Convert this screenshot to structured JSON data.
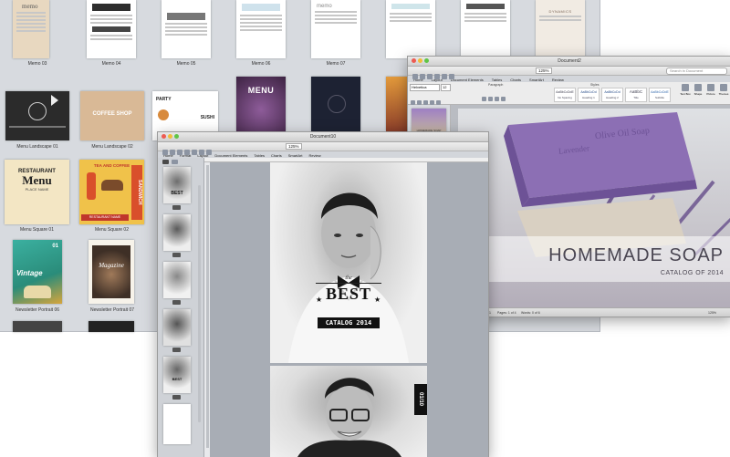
{
  "template_browser": {
    "top_labels": [
      "Memo 03",
      "Memo 04",
      "Memo 05",
      "Memo 06",
      "Memo 07"
    ],
    "memo_word": "memo",
    "dynamics_word": "DYNAMICS",
    "row2_labels": [
      "Menu Landscape 01",
      "Menu Landscape 02"
    ],
    "coffee_shop": "COFFEE SHOP",
    "party": "PARTY",
    "sushi": "SUSHI",
    "menu_word": "MENU",
    "row3_labels": [
      "Menu Square 01",
      "Menu Square 02"
    ],
    "restaurant": "RESTAURANT",
    "menu_big": "Menu",
    "place_name": "PLACE NAME",
    "tea_coffee": "TEA AND COFFEE",
    "sandwich": "SANDWICH",
    "restaurant_name": "RESTAURANT NAME",
    "row4_labels": [
      "Newsletter Portrait 06",
      "Newsletter Portrait 07"
    ],
    "vintage": "Vintage",
    "newsletter_badge": "01",
    "magazine": "Magazine"
  },
  "word_window": {
    "title": "Document2",
    "search_placeholder": "Search in Document",
    "tabs": [
      "Home",
      "Layout",
      "Document Elements",
      "Tables",
      "Charts",
      "SmartArt",
      "Review"
    ],
    "font_name": "Helvetica",
    "font_size": "12",
    "zoom": "125%",
    "styles": [
      {
        "sample": "AaBbCcDdE",
        "name": "No Spacing"
      },
      {
        "sample": "AaBbCcDd",
        "name": "Heading 1"
      },
      {
        "sample": "AaBbCcDd",
        "name": "Heading 2"
      },
      {
        "sample": "AaBbC",
        "name": "Title"
      },
      {
        "sample": "AaBbCcDdE",
        "name": "Subtitle"
      }
    ],
    "ribbon_groups": [
      "Paragraph",
      "Styles"
    ],
    "right_tools": [
      "Text Box",
      "Shape",
      "Picture",
      "Themes"
    ],
    "thumb_caption": "HOMEMADE SOAP",
    "soap_engraving": "Olive Oil Soap",
    "soap_engraving_2": "Lavender",
    "headline": "HOMEMADE SOAP",
    "subheadline": "CATALOG OF 2014",
    "status": {
      "view": "Print Layout View",
      "sec": "Sec 1",
      "pages": "Pages: 1 of 4",
      "words": "Words: 0 of 6"
    }
  },
  "pages_window": {
    "title": "Document10",
    "zoom": "125%",
    "tabs": [
      "Home",
      "Format",
      "Layout",
      "Document Elements",
      "Tables",
      "Charts",
      "SmartArt",
      "Review"
    ],
    "best_small": "the",
    "best": "BEST",
    "catalog": "CATALOG 2014",
    "page_tag": "01/10",
    "thumb_best": "BEST"
  },
  "colors": {
    "lavender": "#8c6fb4",
    "black_band": "#111111",
    "accent_red": "#e8392b",
    "accent_yellow": "#f4c133",
    "vintage_green": "#3aa88c"
  }
}
